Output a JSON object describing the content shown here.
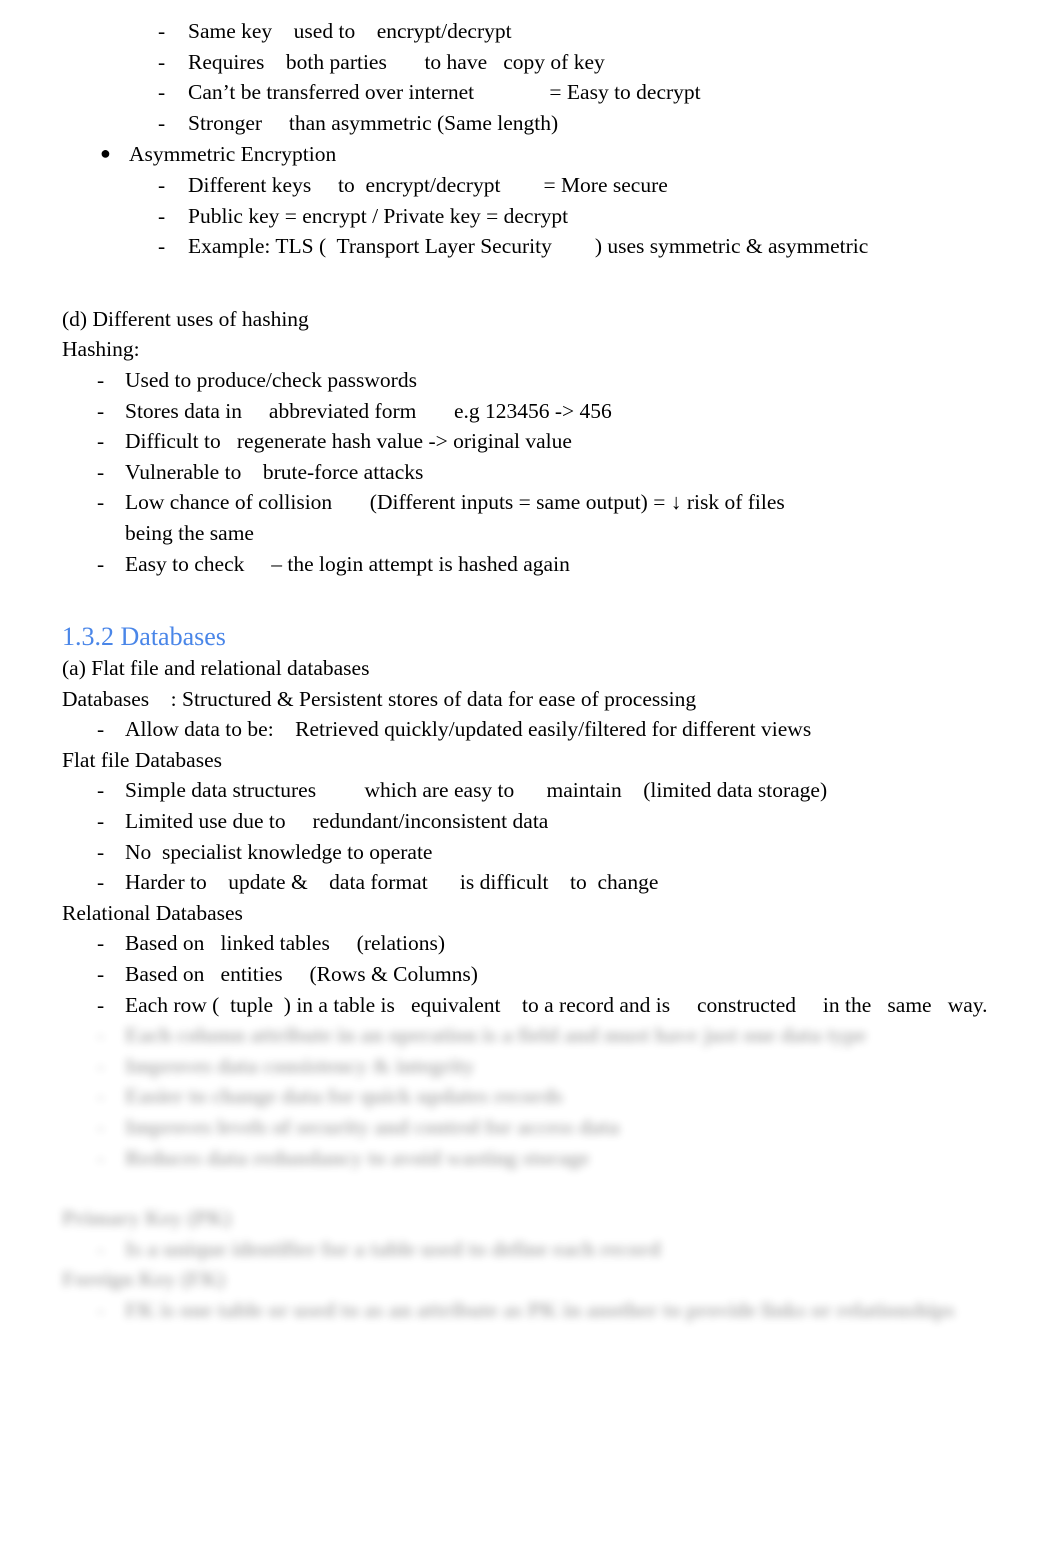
{
  "document": {
    "page_background": "#ffffff",
    "text_color": "#000000",
    "heading_color": "#4a86e8"
  },
  "sections": {
    "symmetric_encryption_details": {
      "bullets": [
        "Same key    used to    encrypt/decrypt",
        "Requires    both parties       to have   copy of key",
        "Can’t be transferred over internet              = Easy to decrypt",
        "Stronger     than asymmetric (Same length)"
      ]
    },
    "asymmetric_encryption": {
      "title": "Asymmetric Encryption",
      "bullet_glyph": "●",
      "bullets": [
        "Different keys     to  encrypt/decrypt        = More secure",
        "Public key = encrypt / Private key = decrypt",
        "Example: TLS (  Transport Layer Security        ) uses symmetric & asymmetric"
      ]
    },
    "hashing": {
      "part_label": "(d) Different uses of hashing",
      "subtitle": "Hashing:",
      "bullets": [
        "Used to produce/check passwords",
        "Stores data in     abbreviated form       e.g 123456 -> 456",
        "Difficult to   regenerate hash value -> original value",
        "Vulnerable to    brute-force attacks",
        "Low chance of collision       (Different inputs = same output) = ↓ risk of files",
        "Easy to check     – the login attempt is hashed again"
      ],
      "collision_wrap_line": "being the same"
    },
    "databases": {
      "heading": "1.3.2 Databases",
      "part_label": "(a) Flat file and relational databases",
      "definition": "Databases    : Structured & Persistent stores of data for ease of processing",
      "definition_bullets": [
        "Allow data to be:    Retrieved quickly/updated easily/filtered for different views"
      ],
      "flat_file": {
        "title": "Flat file Databases",
        "bullets": [
          "Simple data structures         which are easy to      maintain    (limited data storage)",
          "Limited use due to     redundant/inconsistent data",
          "No  specialist knowledge to operate",
          "Harder to    update &    data format      is difficult    to  change"
        ]
      },
      "relational": {
        "title": "Relational Databases",
        "bullets": [
          "Based on   linked tables     (relations)",
          "Based on   entities     (Rows & Columns)",
          "Each row (  tuple  ) in a table is   equivalent    to a record and is     constructed     in the   same   way."
        ]
      },
      "obscured": {
        "note": "blurred-preview",
        "bullets": [
          "Each column attribute in an operation is a field and must have just one data type",
          "Improves data consistency & integrity",
          "Easier to change data for quick updates records",
          "Improves levels of security and control for access data",
          "Reduces data redundancy to avoid wasting storage"
        ],
        "primary_key": {
          "title": "Primary Key (PK)",
          "bullets": [
            "Is a unique identifier for a table used to define each record"
          ]
        },
        "foreign_key": {
          "title": "Foreign Key (FK)",
          "bullets": [
            "FK is one table or used to as an attribute as PK in another to provide links or relationships"
          ]
        }
      }
    }
  }
}
